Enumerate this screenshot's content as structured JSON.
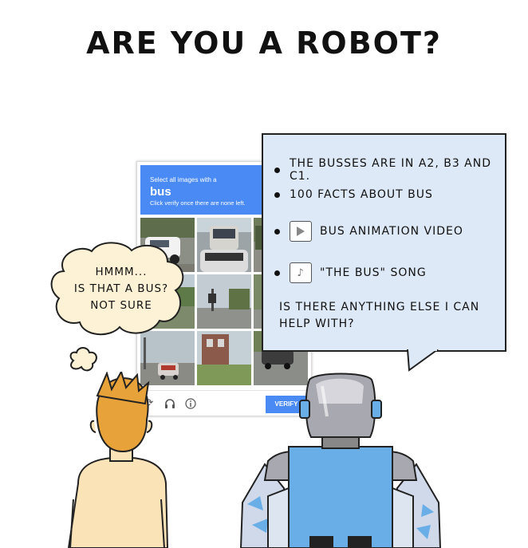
{
  "title": "ARE YOU A ROBOT?",
  "captcha": {
    "instruction": "Select all images with a",
    "target_word": "bus",
    "hint": "Click verify once there are none left.",
    "verify_label": "VERIFY",
    "icons": [
      "refresh-icon",
      "headphones-icon",
      "info-icon"
    ]
  },
  "robot_speech": {
    "bullets": [
      {
        "text": "THE BUSSES ARE IN A2, B3 AND C1."
      },
      {
        "text": "100 FACTS ABOUT BUS"
      },
      {
        "text": "BUS ANIMATION VIDEO",
        "icon": "play-icon"
      },
      {
        "text": "\"THE BUS\" SONG",
        "icon": "music-note-icon"
      }
    ],
    "question": "IS THERE ANYTHING ELSE I CAN HELP WITH?"
  },
  "human_thought": {
    "line1": "HMMM...",
    "line2": "IS THAT A BUS?",
    "line3": "NOT SURE"
  },
  "colors": {
    "captcha_blue": "#4a8af4",
    "speech_bg": "#dde9f7",
    "thought_bg": "#fdf2d5",
    "hair": "#e7a23a",
    "shirt": "#fbe3b8",
    "robot_body": "#6aaee8",
    "robot_head": "#a8a8b0"
  }
}
